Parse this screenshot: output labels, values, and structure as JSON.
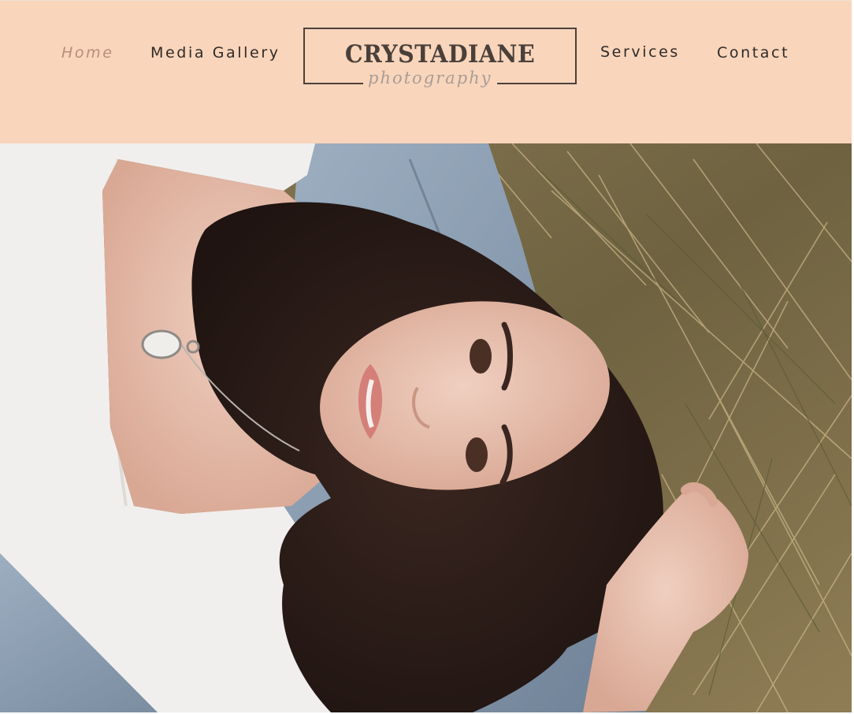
{
  "nav": {
    "home": "Home",
    "media_gallery": "Media Gallery",
    "services": "Services",
    "contact": "Contact"
  },
  "logo": {
    "name": "CRYSTADIANE",
    "tagline": "photography"
  },
  "colors": {
    "header_bg": "#f9d5bb",
    "nav_text": "#2e2a28",
    "nav_active": "#b88e79",
    "logo": "#4a403a",
    "logo_script": "#a89d98"
  },
  "hero": {
    "icon": "hero-photo"
  }
}
